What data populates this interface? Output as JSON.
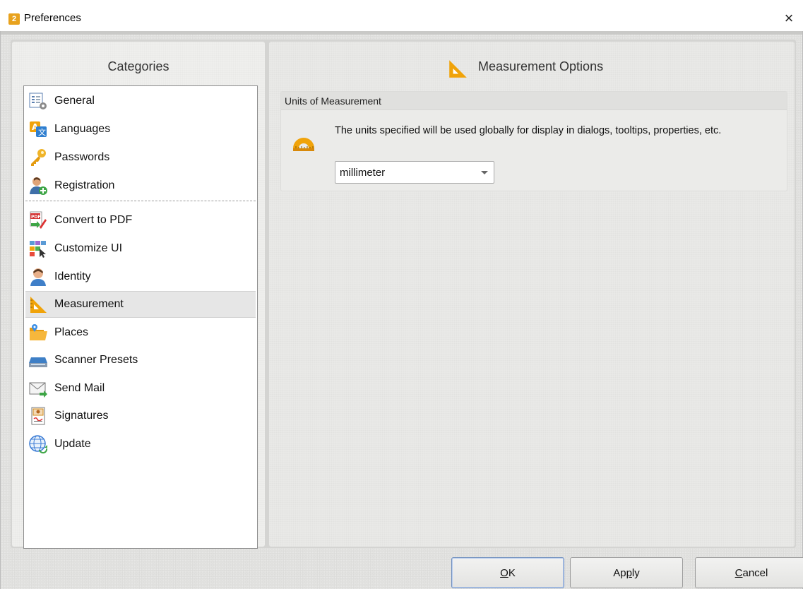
{
  "window": {
    "title": "Preferences",
    "close_glyph": "×",
    "app_icon_glyph": "2"
  },
  "categories": {
    "title": "Categories",
    "items": [
      {
        "label": "General",
        "icon": "general-settings-icon"
      },
      {
        "label": "Languages",
        "icon": "languages-icon"
      },
      {
        "label": "Passwords",
        "icon": "key-icon"
      },
      {
        "label": "Registration",
        "icon": "registration-user-icon"
      },
      {
        "label": "Convert to PDF",
        "icon": "convert-to-pdf-icon"
      },
      {
        "label": "Customize UI",
        "icon": "customize-ui-icon"
      },
      {
        "label": "Identity",
        "icon": "identity-user-icon"
      },
      {
        "label": "Measurement",
        "icon": "ruler-triangle-icon",
        "selected": true
      },
      {
        "label": "Places",
        "icon": "folder-places-icon"
      },
      {
        "label": "Scanner Presets",
        "icon": "scanner-icon"
      },
      {
        "label": "Send Mail",
        "icon": "mail-icon"
      },
      {
        "label": "Signatures",
        "icon": "signature-certificate-icon"
      },
      {
        "label": "Update",
        "icon": "globe-update-icon"
      }
    ]
  },
  "options": {
    "title": "Measurement Options",
    "group": {
      "title": "Units of Measurement",
      "description": "The units specified will be used globally for display in dialogs, tooltips, properties, etc.",
      "unit_selected": "millimeter"
    }
  },
  "buttons": {
    "ok": {
      "prefix": "",
      "mnemonic": "O",
      "suffix": "K"
    },
    "apply": {
      "prefix": "Ap",
      "mnemonic": "p",
      "suffix": "ly"
    },
    "cancel": {
      "prefix": "",
      "mnemonic": "C",
      "suffix": "ancel"
    }
  },
  "colors": {
    "accent_orange": "#f0a30a",
    "selection_bg": "#e6e6e6",
    "default_button_border": "#6f8fbf"
  }
}
